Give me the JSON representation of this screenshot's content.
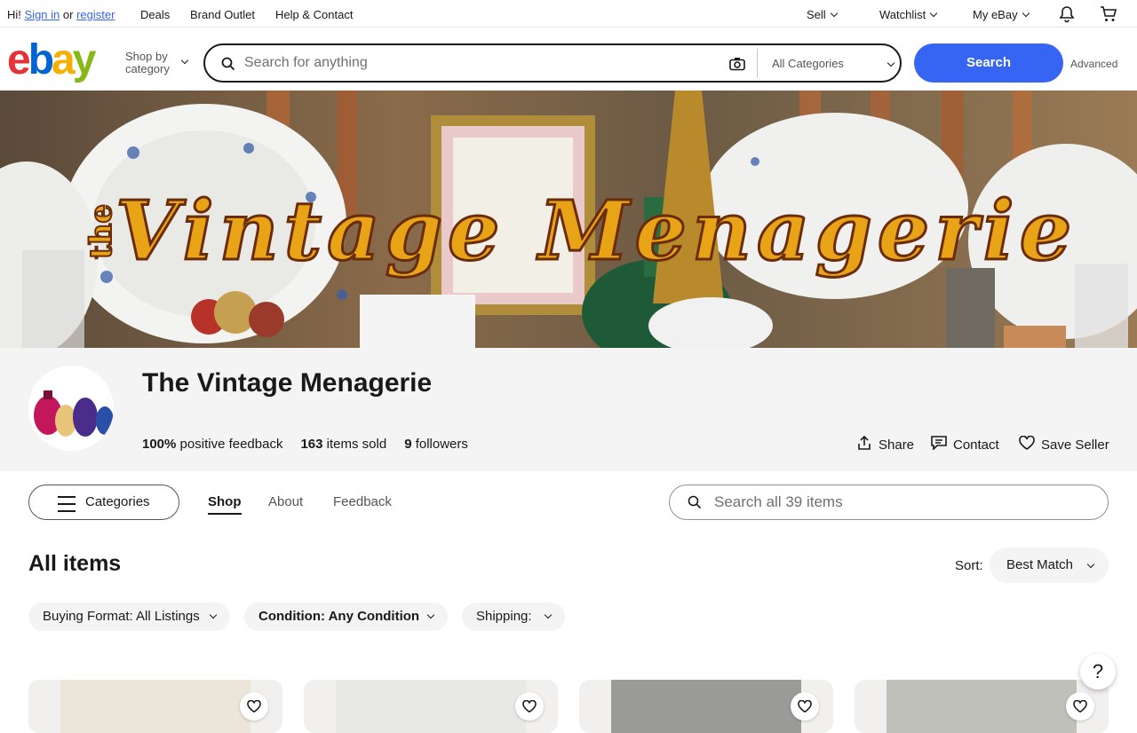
{
  "topbar": {
    "greeting": "Hi!",
    "sign_in": "Sign in",
    "or": "or",
    "register": "register",
    "links": [
      "Deals",
      "Brand Outlet",
      "Help & Contact"
    ],
    "sell": "Sell",
    "watchlist": "Watchlist",
    "my_ebay": "My eBay"
  },
  "header": {
    "logo": [
      "e",
      "b",
      "a",
      "y"
    ],
    "shop_by_1": "Shop by",
    "shop_by_2": "category",
    "search_placeholder": "Search for anything",
    "category_select": "All Categories",
    "search_button": "Search",
    "advanced": "Advanced"
  },
  "banner": {
    "title_small": "the",
    "title": "Vintage Menagerie"
  },
  "store": {
    "name": "The Vintage Menagerie",
    "feedback_value": "100%",
    "feedback_label": "positive feedback",
    "sold_value": "163",
    "sold_label": "items sold",
    "followers_value": "9",
    "followers_label": "followers",
    "share": "Share",
    "contact": "Contact",
    "save": "Save Seller"
  },
  "storenav": {
    "categories": "Categories",
    "tabs": [
      "Shop",
      "About",
      "Feedback"
    ],
    "search_placeholder": "Search all 39 items"
  },
  "listing": {
    "heading": "All items",
    "sort_label": "Sort:",
    "sort_value": "Best Match",
    "filters": [
      "Buying Format: All Listings",
      "Condition: Any Condition",
      "Shipping:"
    ]
  },
  "help": "?",
  "colors": {
    "accent": "#3665f3",
    "logo_e": "#e53238",
    "logo_b": "#0064d2",
    "logo_a": "#f5af02",
    "logo_y": "#86b817",
    "banner_text": "#e8a317"
  }
}
